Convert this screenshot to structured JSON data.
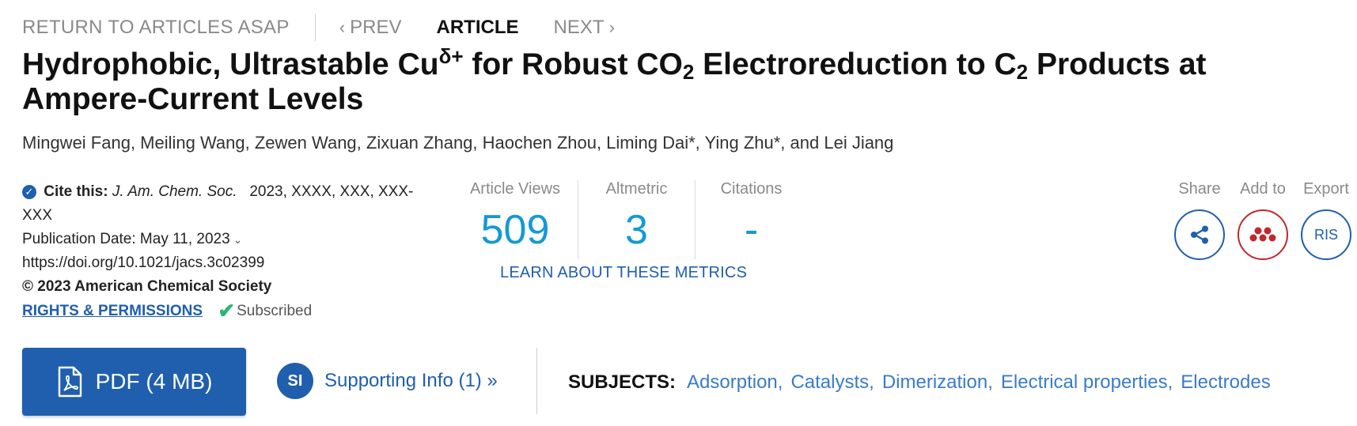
{
  "nav": {
    "return_label": "RETURN TO ARTICLES ASAP",
    "prev_label": "PREV",
    "current_label": "ARTICLE",
    "next_label": "NEXT"
  },
  "article": {
    "title_part1": "Hydrophobic, Ultrastable Cu",
    "title_sup": "δ+",
    "title_part2": " for Robust CO",
    "title_sub1": "2",
    "title_part3": " Electroreduction to C",
    "title_sub2": "2",
    "title_part4": " Products at Ampere-Current Levels",
    "authors": "Mingwei Fang, Meiling Wang, Zewen Wang, Zixuan Zhang, Haochen Zhou, Liming Dai*, Ying Zhu*, and Lei Jiang"
  },
  "cite": {
    "label": "Cite this:",
    "journal": "J. Am. Chem. Soc.",
    "ref": "2023, XXXX, XXX, XXX-XXX",
    "pub_date": "Publication Date: May 11, 2023",
    "doi": "https://doi.org/10.1021/jacs.3c02399",
    "copyright": "© 2023 American Chemical Society",
    "rights_label": "RIGHTS & PERMISSIONS",
    "subscribed_label": "Subscribed"
  },
  "metrics": {
    "views_label": "Article Views",
    "views_value": "509",
    "altmetric_label": "Altmetric",
    "altmetric_value": "3",
    "citations_label": "Citations",
    "citations_value": "-",
    "learn_label": "LEARN ABOUT THESE METRICS"
  },
  "actions": {
    "share_label": "Share",
    "add_label": "Add to",
    "export_label": "Export",
    "export_button": "RIS",
    "share_icon": "share-icon",
    "mendeley_icon": "mendeley-icon"
  },
  "downloads": {
    "pdf_label": "PDF (4 MB)",
    "si_badge": "SI",
    "si_label": "Supporting Info (1) »"
  },
  "subjects": {
    "label": "SUBJECTS:",
    "items": [
      "Adsorption",
      "Catalysts",
      "Dimerization",
      "Electrical properties",
      "Electrodes"
    ]
  },
  "colors": {
    "brand_blue": "#1f5fae",
    "metric_blue": "#139ad6",
    "subject_blue": "#3a7bc8",
    "mendeley_red": "#c0282d",
    "subscribed_green": "#2bb673"
  }
}
